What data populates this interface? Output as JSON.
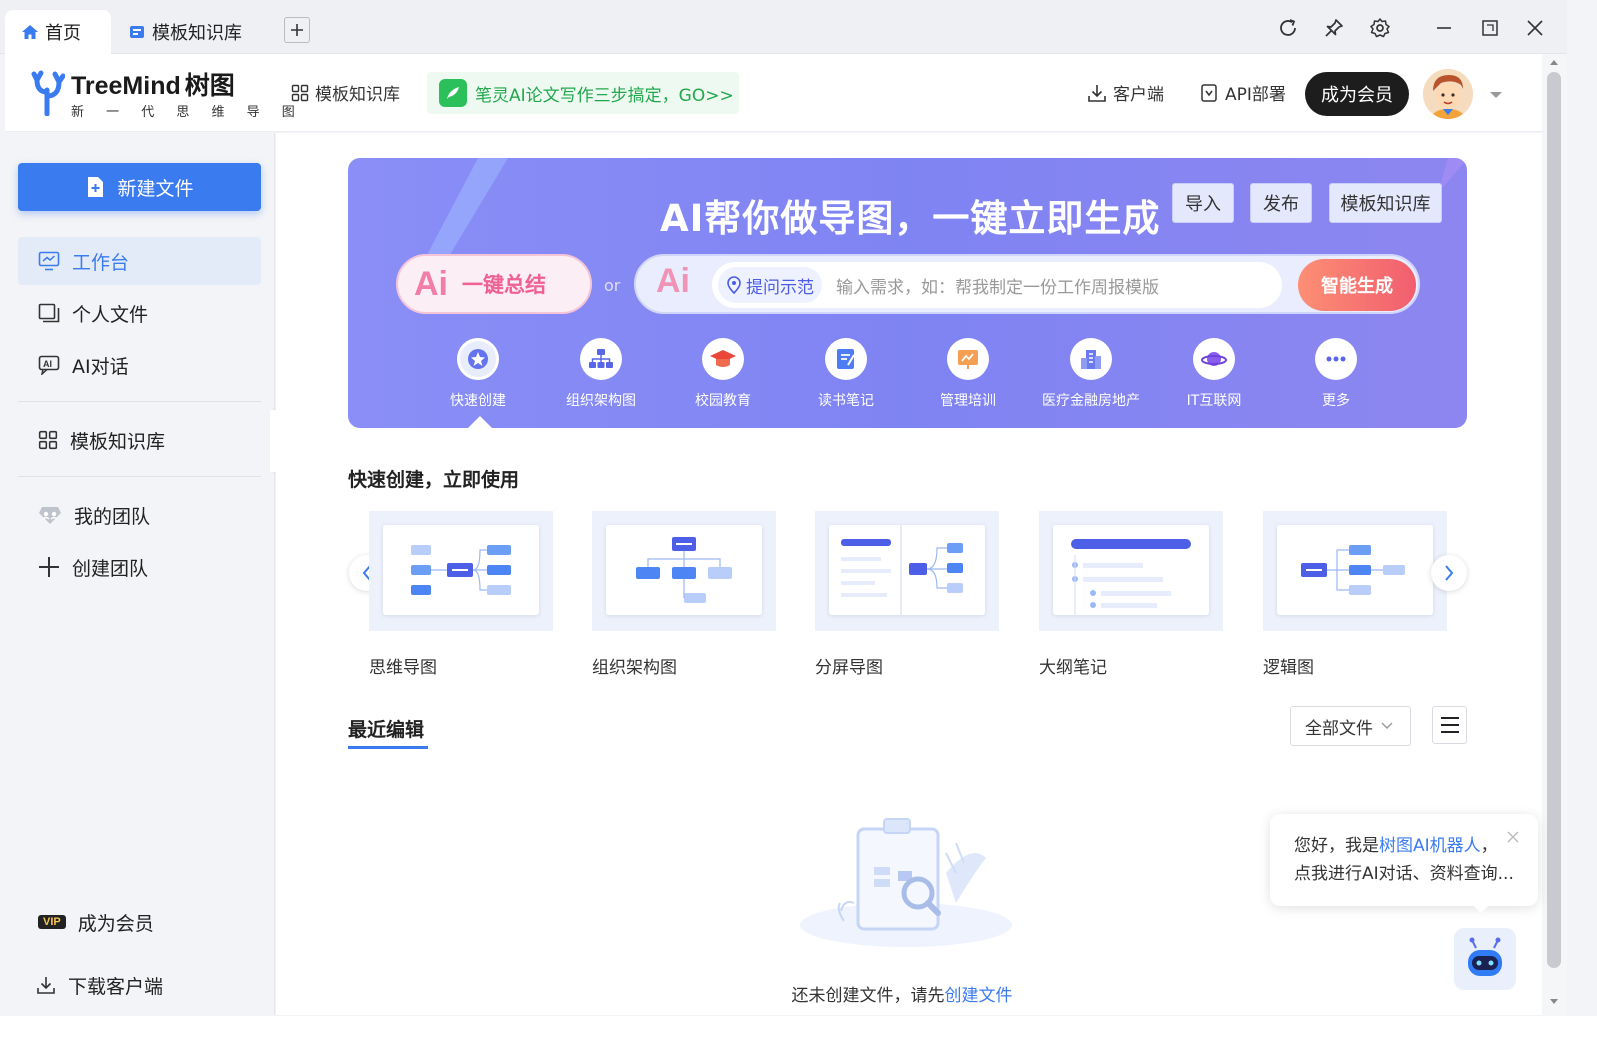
{
  "tabs": [
    {
      "label": "首页",
      "icon": "home-icon",
      "active": true
    },
    {
      "label": "模板知识库",
      "icon": "template-library-icon",
      "active": false
    }
  ],
  "header": {
    "brand": "TreeMind",
    "brand_cn": "树图",
    "tagline": "新 一 代 思 维 导 图",
    "template_library": "模板知识库",
    "promo": "笔灵AI论文写作三步搞定，GO>>",
    "client": "客户端",
    "api": "API部署",
    "vip": "成为会员"
  },
  "sidebar": {
    "new_file": "新建文件",
    "items": [
      {
        "label": "工作台",
        "icon": "workbench-icon",
        "active": true
      },
      {
        "label": "个人文件",
        "icon": "folder-icon"
      },
      {
        "label": "AI对话",
        "icon": "ai-chat-icon"
      },
      {
        "label": "模板知识库",
        "icon": "grid-icon"
      },
      {
        "label": "我的团队",
        "icon": "team-icon"
      },
      {
        "label": "创建团队",
        "icon": "plus-icon"
      }
    ],
    "become_vip": "成为会员",
    "vip_badge": "VIP",
    "download_client": "下载客户端"
  },
  "banner": {
    "title": "AI帮你做导图，一键立即生成",
    "buttons": [
      "导入",
      "发布",
      "模板知识库"
    ],
    "summary_ai": "Ai",
    "summary_label": "一键总结",
    "or": "or",
    "gen_ai": "Ai",
    "ask_tip": "提问示范",
    "placeholder": "输入需求，如：帮我制定一份工作周报模版",
    "generate": "智能生成",
    "categories": [
      "快速创建",
      "组织架构图",
      "校园教育",
      "读书笔记",
      "管理培训",
      "医疗金融房地产",
      "IT互联网",
      "更多"
    ]
  },
  "quick": {
    "title": "快速创建，立即使用",
    "templates": [
      "思维导图",
      "组织架构图",
      "分屏导图",
      "大纲笔记",
      "逻辑图"
    ]
  },
  "recent": {
    "title": "最近编辑",
    "filter": "全部文件",
    "empty_prefix": "还未创建文件，请先",
    "empty_link": "创建文件"
  },
  "chat": {
    "line1_prefix": "您好，我是",
    "line1_highlight": "树图AI机器人",
    "line1_suffix": "，",
    "line2": "点我进行AI对话、资料查询..."
  },
  "colors": {
    "accent": "#3a7bf0",
    "banner": "#8a8ef6",
    "generate": "#f15e6f"
  }
}
